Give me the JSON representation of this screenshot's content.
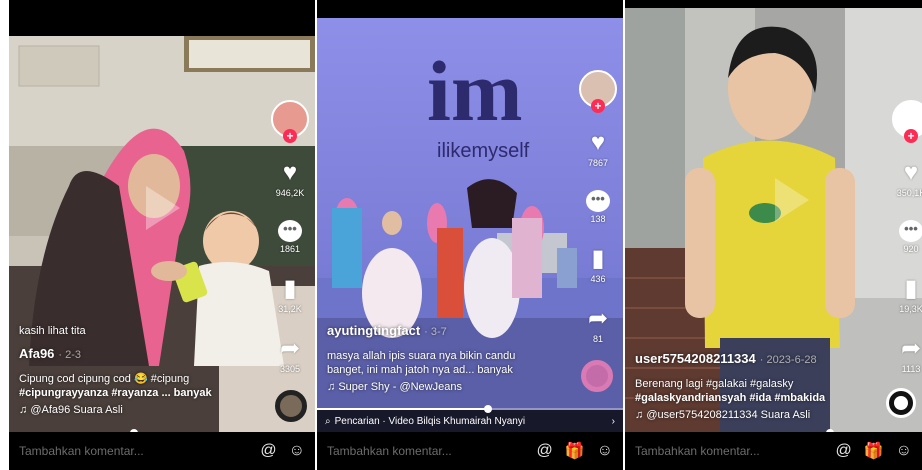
{
  "comment_placeholder": "Tambahkan komentar...",
  "colors": {
    "like_red": "#fe2c55",
    "progress": "#ffffff"
  },
  "icons": {
    "at": "@",
    "emoji": "☺",
    "gift": "🎁",
    "music": "♫",
    "search": "⌕"
  },
  "panel1": {
    "likes": "946,2K",
    "comments": "1861",
    "saves": "31,2K",
    "shares": "3305",
    "overlay_text": "kasih lihat tita",
    "username": "Afa96",
    "date": "· 2-3",
    "caption_line1": "Cipung cod cipung cod 😂  #cipung",
    "caption_line2": "#cipungrayyanza #rayanza ... banyak",
    "sound": "@Afa96 Suara Asli",
    "progress": 0.41
  },
  "panel2": {
    "likes": "7867",
    "comments": "138",
    "saves": "436",
    "shares": "81",
    "banner_big": "im",
    "banner_small": "ilikemyself",
    "username": "ayutingtingfact",
    "date": "· 3-7",
    "caption_line1": "masya allah ipis suara nya bikin candu",
    "caption_line2": "banget, ini mah jatoh nya ad... banyak",
    "sound": "Super Shy - @NewJeans",
    "search_text": "Pencarian · Video Bilqis Khumairah Nyanyi",
    "progress": 0.56
  },
  "panel3": {
    "likes": "350,1K",
    "comments": "920",
    "saves": "19,3K",
    "shares": "1113",
    "username": "user5754208211334",
    "date": "· 2023-6-28",
    "caption_line1": "Berenang lagi #galakai #galasky",
    "caption_line2": "#galaskyandriansyah #ida #mbakida",
    "sound": "@user5754208211334 Suara Asli",
    "progress": 0.69
  }
}
